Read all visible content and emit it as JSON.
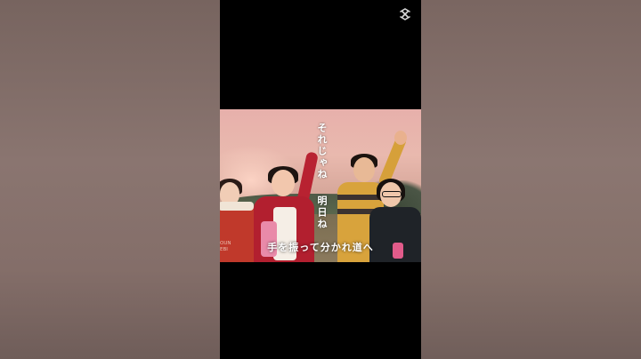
{
  "video": {
    "lyric_line_1": "それじゃね",
    "lyric_line_2": "明日ね",
    "subtitle": "手を振って分かれ道へ",
    "corner_text": "OUN\nEBI"
  },
  "logo": {
    "icon": "capcut-logo-icon"
  },
  "colors": {
    "backdrop": "#7d6b66",
    "phone_bg": "#000000",
    "caption": "#ffffff"
  }
}
